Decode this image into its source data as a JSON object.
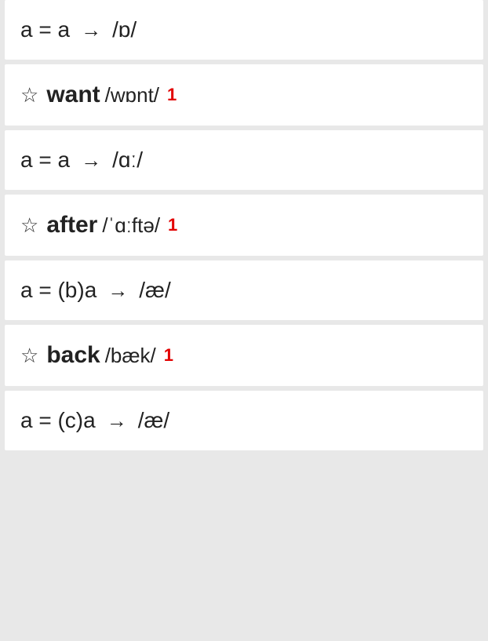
{
  "cards": [
    {
      "type": "rule",
      "left": "a = a",
      "arrow": "→",
      "right": "/ɒ/"
    },
    {
      "type": "entry",
      "star": "☆",
      "word": "want",
      "ipa": "/wɒnt/",
      "badge": "1"
    },
    {
      "type": "rule",
      "left": "a = a",
      "arrow": "→",
      "right": "/ɑː/"
    },
    {
      "type": "entry",
      "star": "☆",
      "word": "after",
      "ipa": "/ˈɑːftə/",
      "badge": "1"
    },
    {
      "type": "rule",
      "left": "a = (b)a",
      "arrow": "→",
      "right": "/æ/"
    },
    {
      "type": "entry",
      "star": "☆",
      "word": "back",
      "ipa": "/bæk/",
      "badge": "1"
    },
    {
      "type": "rule",
      "left": "a = (c)a",
      "arrow": "→",
      "right": "/æ/"
    }
  ]
}
